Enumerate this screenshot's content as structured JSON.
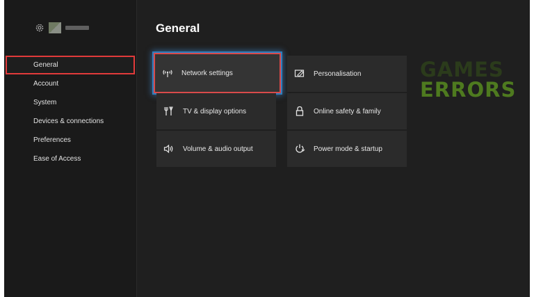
{
  "sidebar": {
    "items": [
      {
        "label": "General",
        "active": true
      },
      {
        "label": "Account"
      },
      {
        "label": "System"
      },
      {
        "label": "Devices & connections"
      },
      {
        "label": "Preferences"
      },
      {
        "label": "Ease of Access"
      }
    ]
  },
  "page": {
    "title": "General"
  },
  "tiles": [
    {
      "label": "Network settings",
      "icon": "network-icon",
      "focused": true
    },
    {
      "label": "Personalisation",
      "icon": "personalisation-icon"
    },
    {
      "label": "TV & display options",
      "icon": "tv-display-icon"
    },
    {
      "label": "Online safety & family",
      "icon": "lock-icon"
    },
    {
      "label": "Volume & audio output",
      "icon": "speaker-icon"
    },
    {
      "label": "Power mode & startup",
      "icon": "power-icon"
    }
  ],
  "watermark": {
    "line1": "GAMES",
    "line2": "ERRORS"
  },
  "colors": {
    "focus_border": "#d94a4a",
    "focus_glow": "#2f7fbf",
    "watermark": "#4e7a1f"
  }
}
